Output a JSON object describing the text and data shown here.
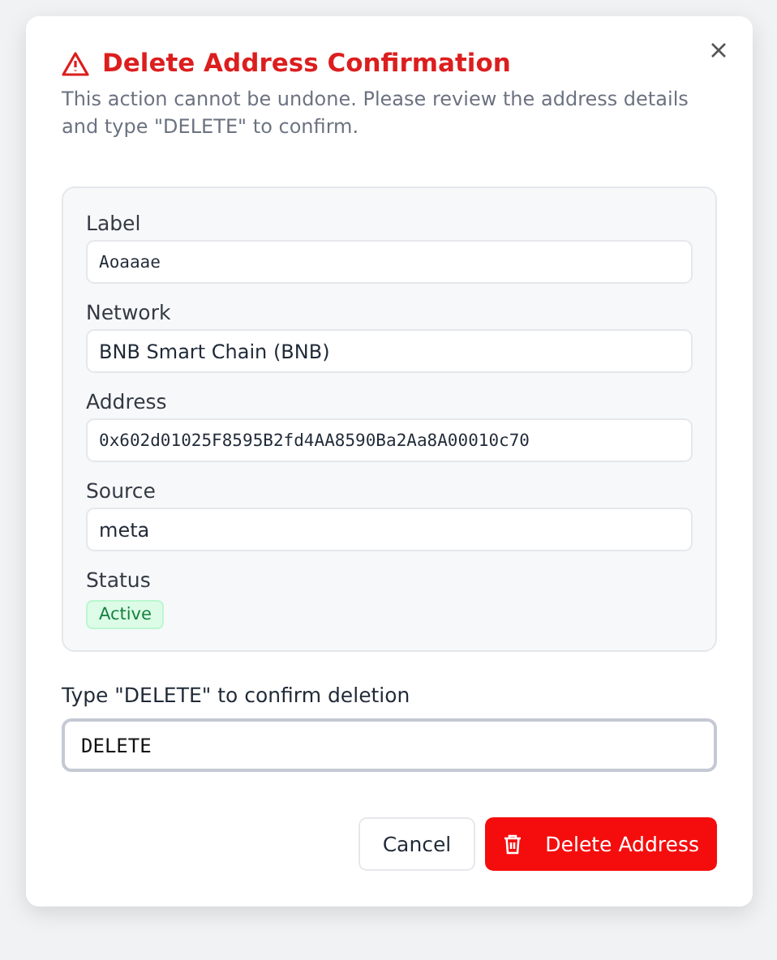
{
  "dialog": {
    "title": "Delete Address Confirmation",
    "description": "This action cannot be undone. Please review the address details and type \"DELETE\" to confirm.",
    "details": [
      {
        "label": "Label",
        "kind": "code",
        "value": "Aoaaae"
      },
      {
        "label": "Network",
        "kind": "text",
        "value": "BNB Smart Chain (BNB)"
      },
      {
        "label": "Address",
        "kind": "code",
        "value": "0x602d01025F8595B2fd4AA8590Ba2Aa8A00010c70"
      },
      {
        "label": "Source",
        "kind": "text",
        "value": "meta"
      },
      {
        "label": "Status",
        "kind": "badge",
        "value": "Active"
      }
    ],
    "confirm": {
      "label": "Type \"DELETE\" to confirm deletion",
      "value": "DELETE"
    },
    "buttons": [
      {
        "kind": "secondary",
        "label": "Cancel"
      },
      {
        "kind": "danger",
        "label": "Delete Address"
      }
    ]
  }
}
